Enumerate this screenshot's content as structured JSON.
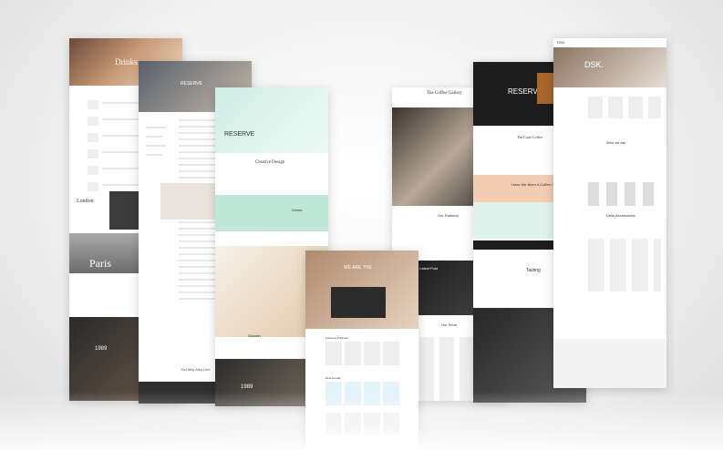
{
  "page1": {
    "hero_title": "Drinks",
    "city1": "London",
    "city2": "Paris",
    "date1": "1989",
    "date2": "1989"
  },
  "page2": {
    "brand": "RESERVE",
    "footer_text": "You May Also Like"
  },
  "page3": {
    "brand": "RESERVE",
    "hero_subtitle": "Creative Design",
    "mug_title": "Drinks",
    "box_title": "Wonder",
    "date": "1989"
  },
  "page4": {
    "hero_title": "WE ARE THE",
    "section1": "Featured Products",
    "section2": "New Arrivals"
  },
  "page5": {
    "title": "The Coffee Gallery",
    "partners": "Our Partners",
    "store": "Our Store",
    "tag": "Latest Post"
  },
  "page6": {
    "brand": "RESERVE",
    "section": "The Crate Coffee",
    "cta": "Have We Been A Coffee Cup?",
    "cta2": "Tasting"
  },
  "page7": {
    "brand": "DSK.",
    "section": "Who we are",
    "sub": "Desk Accessories"
  },
  "colors": {
    "accent_green": "#7fd3b0",
    "peach": "#f3cdb2",
    "dark": "#1d1d1d",
    "mint": "#dff3ec"
  }
}
